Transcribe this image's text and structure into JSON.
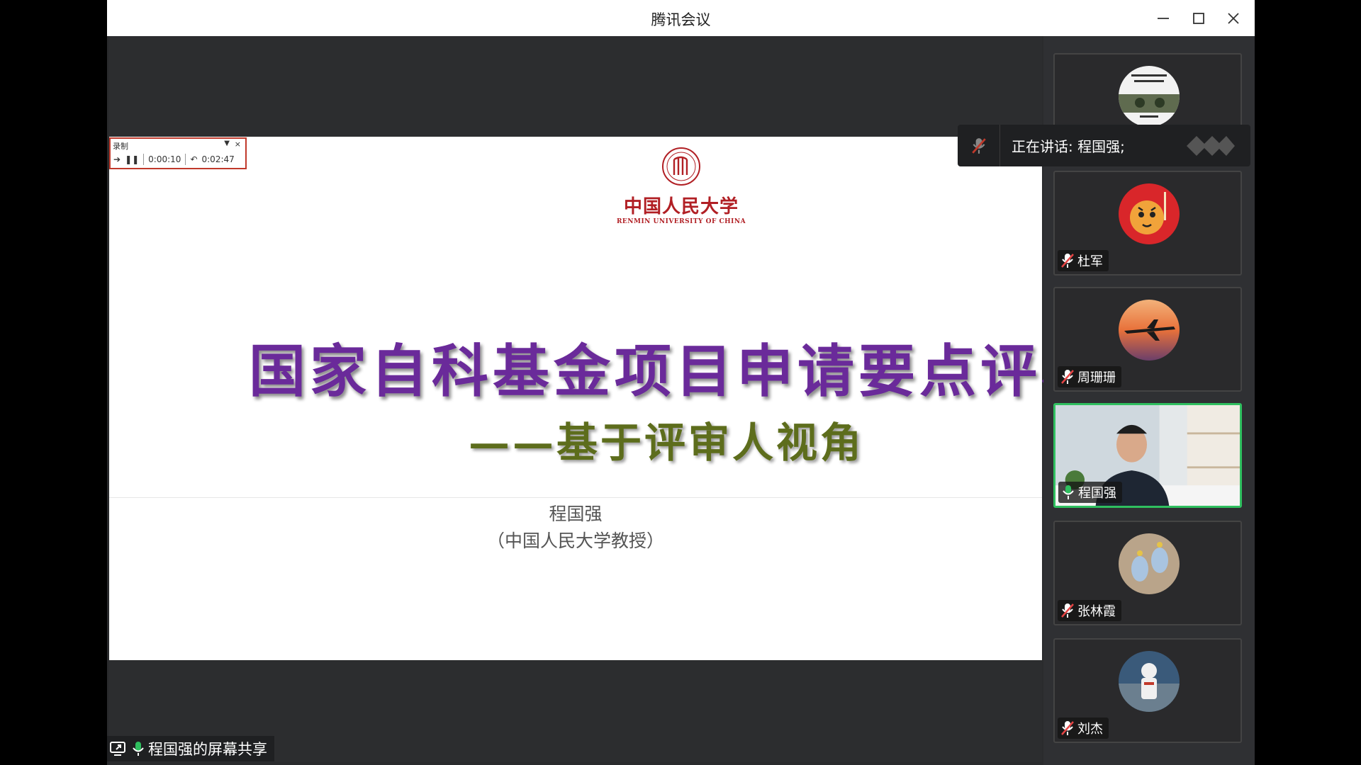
{
  "window": {
    "title": "腾讯会议"
  },
  "recording_bar": {
    "label": "录制",
    "elapsed": "0:00:10",
    "remaining": "0:02:47"
  },
  "slide": {
    "logo_cn": "中国人民大学",
    "logo_en": "RENMIN UNIVERSITY OF CHINA",
    "title": "国家自科基金项目申请要点评析",
    "subtitle": "——基于评审人视角",
    "presenter": "程国强",
    "affiliation": "（中国人民大学教授）"
  },
  "share_label": "程国强的屏幕共享",
  "speaking": {
    "text": "正在讲话: 程国强;"
  },
  "participants": [
    {
      "name": "",
      "avatar": "poster-avatar",
      "muted": true
    },
    {
      "name": "杜军",
      "avatar": "tiger-avatar",
      "muted": true
    },
    {
      "name": "周珊珊",
      "avatar": "airplane-sunset-avatar",
      "muted": true
    },
    {
      "name": "程国强",
      "avatar": "camera-video",
      "muted": false,
      "active": true
    },
    {
      "name": "张林霞",
      "avatar": "earrings-avatar",
      "muted": true
    },
    {
      "name": "刘杰",
      "avatar": "astronaut-avatar",
      "muted": true
    }
  ],
  "colors": {
    "title_purple": "#6a2a9a",
    "subtitle_olive": "#5d6d1c",
    "brand_red": "#b11f24",
    "active_green": "#2fbf5f"
  }
}
